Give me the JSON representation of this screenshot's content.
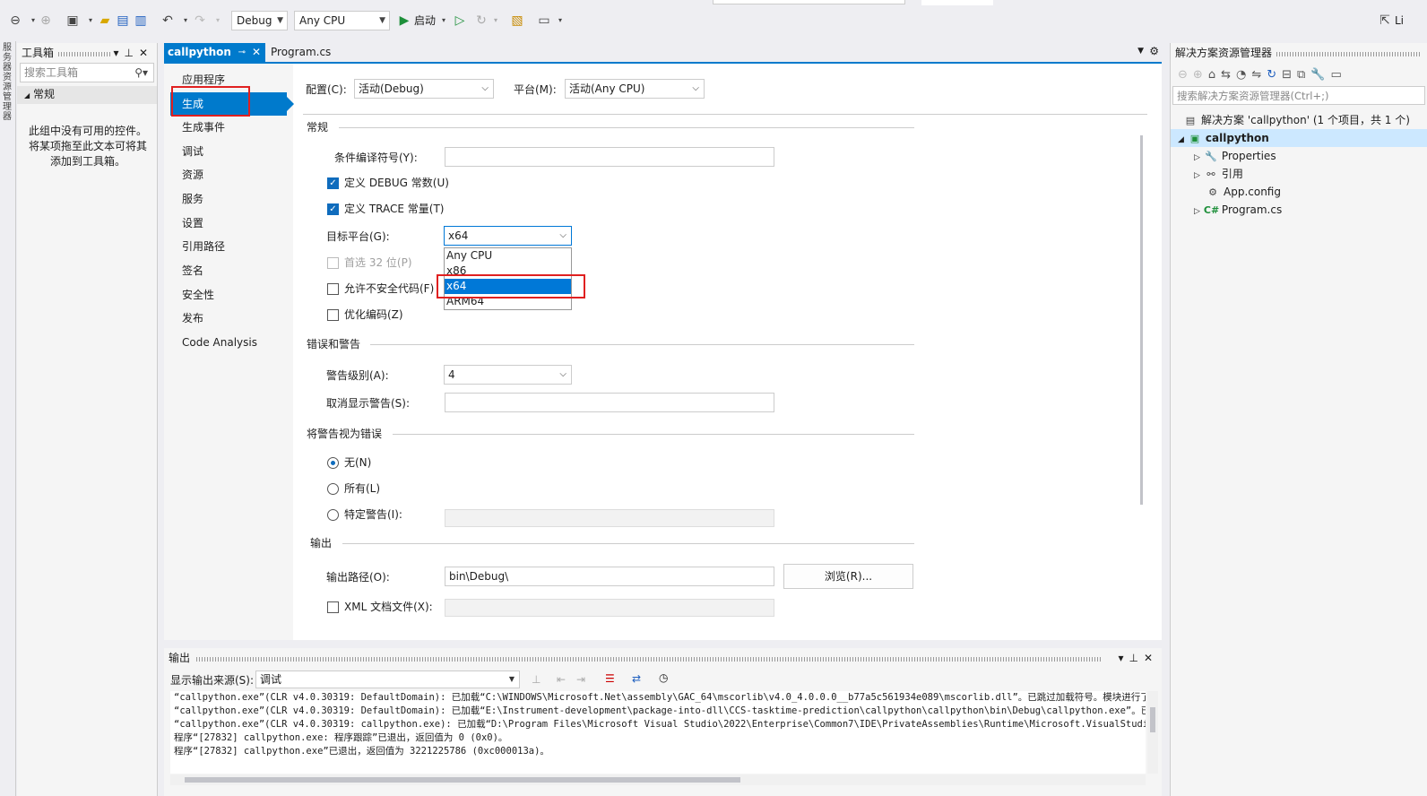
{
  "toolbar": {
    "config": "Debug",
    "platform": "Any CPU",
    "start_label": "启动",
    "right_label": "Li"
  },
  "left_strip": {
    "label": "服务器资源管理器"
  },
  "toolbox": {
    "title": "工具箱",
    "search_placeholder": "搜索工具箱",
    "group": "常规",
    "empty_message": "此组中没有可用的控件。将某项拖至此文本可将其添加到工具箱。"
  },
  "tabs": [
    {
      "label": "callpython"
    },
    {
      "label": "Program.cs"
    }
  ],
  "nav": {
    "items": [
      "应用程序",
      "生成",
      "生成事件",
      "调试",
      "资源",
      "服务",
      "设置",
      "引用路径",
      "签名",
      "安全性",
      "发布",
      "Code Analysis"
    ]
  },
  "config_row": {
    "config_label": "配置(C):",
    "config_value": "活动(Debug)",
    "platform_label": "平台(M):",
    "platform_value": "活动(Any CPU)"
  },
  "general": {
    "title": "常规",
    "symbols_label": "条件编译符号(Y):",
    "symbols_value": "",
    "debug_label": "定义 DEBUG 常数(U)",
    "trace_label": "定义 TRACE 常量(T)",
    "target_label": "目标平台(G):",
    "target_value": "x64",
    "prefer32_label": "首选 32 位(P)",
    "unsafe_label": "允许不安全代码(F)",
    "optimize_label": "优化编码(Z)",
    "target_options": [
      "Any CPU",
      "x86",
      "x64",
      "ARM64"
    ]
  },
  "errors": {
    "title": "错误和警告",
    "level_label": "警告级别(A):",
    "level_value": "4",
    "suppress_label": "取消显示警告(S):",
    "suppress_value": ""
  },
  "treat": {
    "title": "将警告视为错误",
    "none_label": "无(N)",
    "all_label": "所有(L)",
    "specific_label": "特定警告(I):"
  },
  "output_section": {
    "title": "输出",
    "path_label": "输出路径(O):",
    "path_value": "bin\\Debug\\",
    "browse_label": "浏览(R)...",
    "xml_label": "XML 文档文件(X):"
  },
  "output_panel": {
    "title": "输出",
    "source_label": "显示输出来源(S):",
    "source_value": "调试",
    "lines": [
      "“callpython.exe”(CLR v4.0.30319: DefaultDomain): 已加载“C:\\WINDOWS\\Microsoft.Net\\assembly\\GAC_64\\mscorlib\\v4.0_4.0.0.0__b77a5c561934e089\\mscorlib.dll”。已跳过加载符号。模块进行了优",
      "“callpython.exe”(CLR v4.0.30319: DefaultDomain): 已加载“E:\\Instrument-development\\package-into-dll\\CCS-tasktime-prediction\\callpython\\callpython\\bin\\Debug\\callpython.exe”。已加载符",
      "“callpython.exe”(CLR v4.0.30319: callpython.exe): 已加载“D:\\Program Files\\Microsoft Visual Studio\\2022\\Enterprise\\Common7\\IDE\\PrivateAssemblies\\Runtime\\Microsoft.VisualStudio.Debug",
      "程序“[27832] callpython.exe: 程序跟踪”已退出，返回值为 0 (0x0)。",
      "程序“[27832] callpython.exe”已退出，返回值为 3221225786 (0xc000013a)。"
    ]
  },
  "solution_explorer": {
    "title": "解决方案资源管理器",
    "search_placeholder": "搜索解决方案资源管理器(Ctrl+;)",
    "solution": "解决方案 'callpython' (1 个项目，共 1 个)",
    "project": "callpython",
    "items": [
      "Properties",
      "引用",
      "App.config",
      "Program.cs"
    ]
  }
}
